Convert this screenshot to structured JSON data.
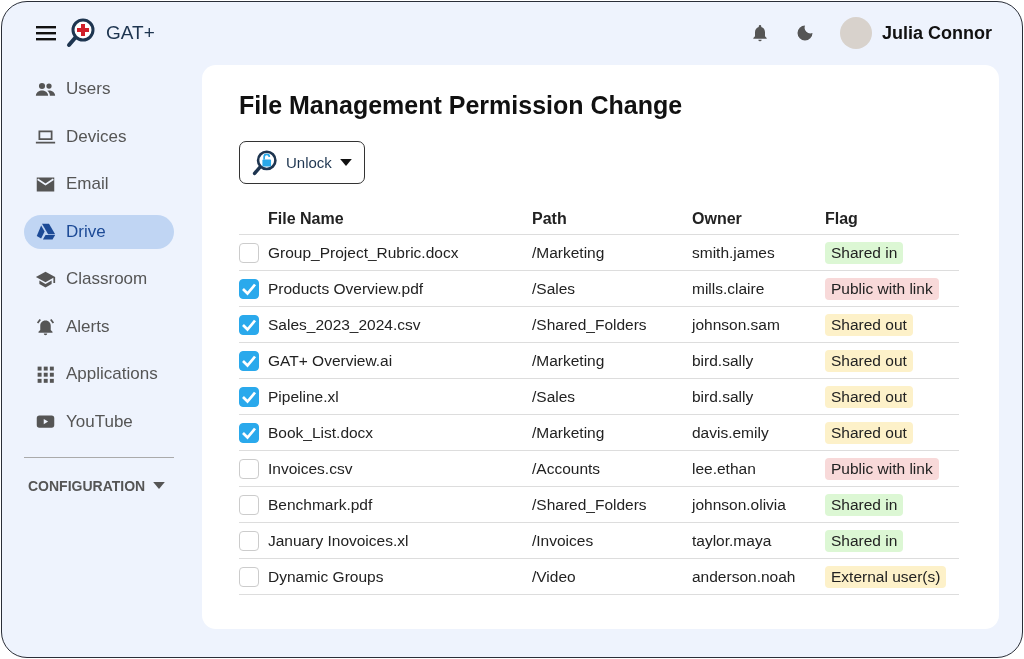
{
  "app": {
    "name": "GAT+"
  },
  "header": {
    "user_name": "Julia Connor"
  },
  "sidebar": {
    "items": [
      {
        "label": "Users",
        "selected": false
      },
      {
        "label": "Devices",
        "selected": false
      },
      {
        "label": "Email",
        "selected": false
      },
      {
        "label": "Drive",
        "selected": true
      },
      {
        "label": "Classroom",
        "selected": false
      },
      {
        "label": "Alerts",
        "selected": false
      },
      {
        "label": "Applications",
        "selected": false
      },
      {
        "label": "YouTube",
        "selected": false
      }
    ],
    "section": "CONFIGURATION"
  },
  "page": {
    "title": "File Management Permission Change",
    "action_button": "Unlock"
  },
  "table": {
    "columns": [
      "File Name",
      "Path",
      "Owner",
      "Flag"
    ],
    "rows": [
      {
        "checked": false,
        "name": "Group_Project_Rubric.docx",
        "path": "/Marketing",
        "owner": "smith.james",
        "flag": "Shared in",
        "color": "#dcf7d4"
      },
      {
        "checked": true,
        "name": "Products Overview.pdf",
        "path": "/Sales",
        "owner": "mills.claire",
        "flag": "Public with link",
        "color": "#f8d9d9"
      },
      {
        "checked": true,
        "name": "Sales_2023_2024.csv",
        "path": "/Shared_Folders",
        "owner": "johnson.sam",
        "flag": "Shared out",
        "color": "#fdf1c9"
      },
      {
        "checked": true,
        "name": "GAT+ Overview.ai",
        "path": "/Marketing",
        "owner": "bird.sally",
        "flag": "Shared out",
        "color": "#fdf1c9"
      },
      {
        "checked": true,
        "name": "Pipeline.xl",
        "path": "/Sales",
        "owner": "bird.sally",
        "flag": "Shared out",
        "color": "#fdf1c9"
      },
      {
        "checked": true,
        "name": "Book_List.docx",
        "path": "/Marketing",
        "owner": "davis.emily",
        "flag": "Shared out",
        "color": "#fdf1c9"
      },
      {
        "checked": false,
        "name": "Invoices.csv",
        "path": "/Accounts",
        "owner": "lee.ethan",
        "flag": "Public with link",
        "color": "#f8d9d9"
      },
      {
        "checked": false,
        "name": "Benchmark.pdf",
        "path": "/Shared_Folders",
        "owner": "johnson.olivia",
        "flag": "Shared in",
        "color": "#dcf7d4"
      },
      {
        "checked": false,
        "name": "January Inovoices.xl",
        "path": "/Invoices",
        "owner": "taylor.maya",
        "flag": "Shared in",
        "color": "#dcf7d4"
      },
      {
        "checked": false,
        "name": "Dynamic Groups",
        "path": "/Video",
        "owner": "anderson.noah",
        "flag": "External user(s)",
        "color": "#fdf1c9"
      }
    ]
  }
}
